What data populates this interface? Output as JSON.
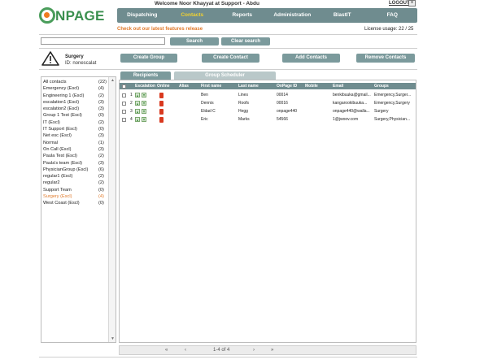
{
  "header": {
    "welcome": "Welcome Noor Khayyat at Support - Abdu",
    "logout": "LOGOUT",
    "close_glyph": "×",
    "logo_text": "NPAGE",
    "logo_icon": "onpage-o-logo"
  },
  "nav": {
    "tabs": [
      "Dispatching",
      "Contacts",
      "Reports",
      "Administration",
      "BlastIT",
      "FAQ"
    ],
    "active": "Contacts"
  },
  "features_link": "Check out our latest features release",
  "license": "License usage: 22 / 25",
  "search": {
    "placeholder": "",
    "value": "",
    "search_label": "Search",
    "clear_label": "Clear search"
  },
  "group": {
    "name": "Surgery",
    "id_label": "ID: nonescalat",
    "icon": "warning-triangle-icon"
  },
  "actions": {
    "create_group": "Create Group",
    "create_contact": "Create Contact",
    "add_contacts": "Add Contacts",
    "remove_contacts": "Remove Contacts"
  },
  "groups": [
    {
      "name": "All contacts",
      "count": "(22)"
    },
    {
      "name": "Emergency (Escl)",
      "count": "(4)"
    },
    {
      "name": "Engineering 1 (Escl)",
      "count": "(2)"
    },
    {
      "name": "escalation1 (Escl)",
      "count": "(3)"
    },
    {
      "name": "escalation2 (Escl)",
      "count": "(3)"
    },
    {
      "name": "Group 1 Test (Escl)",
      "count": "(0)"
    },
    {
      "name": "IT (Escl)",
      "count": "(2)"
    },
    {
      "name": "IT Support (Escl)",
      "count": "(0)"
    },
    {
      "name": "Net esc (Escl)",
      "count": "(3)"
    },
    {
      "name": "Normal",
      "count": "(1)"
    },
    {
      "name": "On Call (Escl)",
      "count": "(3)"
    },
    {
      "name": "Paula Test (Escl)",
      "count": "(2)"
    },
    {
      "name": "Paula's team (Escl)",
      "count": "(3)"
    },
    {
      "name": "PhysicianGroup (Escl)",
      "count": "(6)"
    },
    {
      "name": "regular1 (Escl)",
      "count": "(2)"
    },
    {
      "name": "regular2",
      "count": "(2)"
    },
    {
      "name": "Support Team",
      "count": "(0)"
    },
    {
      "name": "Surgery (Escl)",
      "count": "(4)",
      "selected": true
    },
    {
      "name": "West Coast (Escl)",
      "count": "(0)"
    }
  ],
  "tabs": {
    "recipients": "Recipients",
    "scheduler": "Group Scheduler"
  },
  "table": {
    "columns": [
      "Escalation",
      "Online",
      "Alias",
      "First name",
      "Last name",
      "OnPage ID",
      "Mobile",
      "Email",
      "Groups"
    ],
    "rows": [
      {
        "num": "1",
        "alias": "",
        "first": "Ben",
        "last": "Lines",
        "id": "00014",
        "mobile": "",
        "email": "benkibuuka@gmail...",
        "groups": "Emergency,Surger..."
      },
      {
        "num": "2",
        "alias": "",
        "first": "Dennis",
        "last": "Roofs",
        "id": "00016",
        "mobile": "",
        "email": "kangarookibuuka...",
        "groups": "Emergency,Surgery"
      },
      {
        "num": "3",
        "alias": "",
        "first": "Eldad C",
        "last": "Hegg",
        "id": "onpage440",
        "mobile": "",
        "email": "onpage440@walla...",
        "groups": "Surgery"
      },
      {
        "num": "4",
        "alias": "",
        "first": "Eric",
        "last": "Marks",
        "id": "54566",
        "mobile": "",
        "email": "1@jwoov.com",
        "groups": "Surgery,Physician..."
      }
    ]
  },
  "pager": {
    "first": "«",
    "prev": "‹",
    "count": "1-4 of 4",
    "next": "›",
    "last": "»"
  },
  "colors": {
    "nav_bg": "#6f8c8f",
    "button_bg": "#7b9a9c",
    "active_nav": "#f2d230",
    "accent_orange": "#e07a2b",
    "logo_green": "#3a8f4e"
  }
}
